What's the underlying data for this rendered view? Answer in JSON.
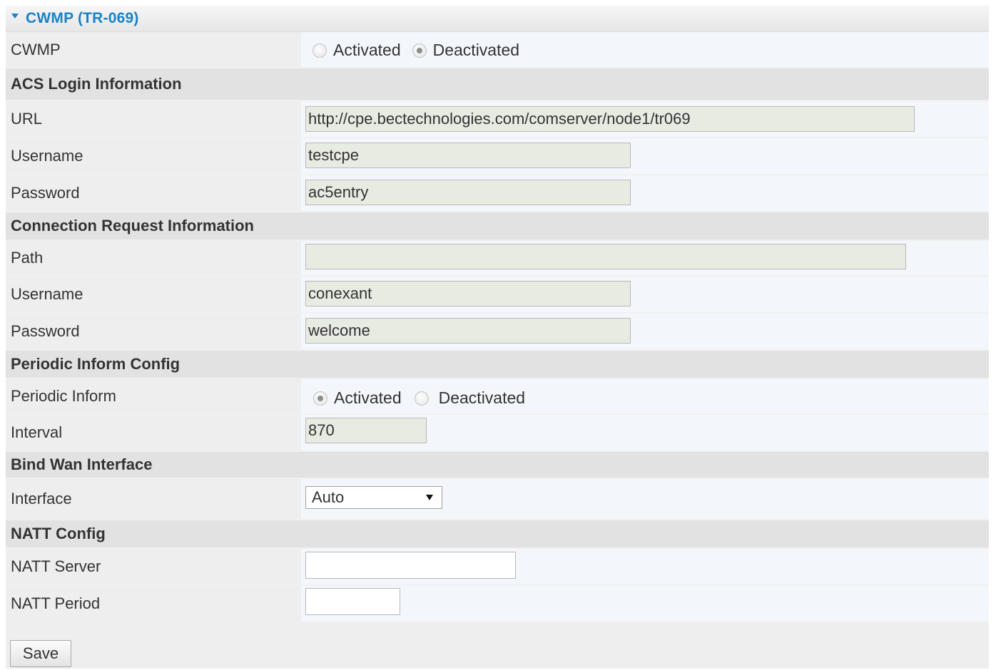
{
  "title": "CWMP (TR-069)",
  "cwmp": {
    "label": "CWMP",
    "options": [
      "Activated",
      "Deactivated"
    ],
    "selected": "Deactivated"
  },
  "acs": {
    "section_title": "ACS Login Information",
    "url_label": "URL",
    "url_value": "http://cpe.bectechnologies.com/comserver/node1/tr069",
    "username_label": "Username",
    "username_value": "testcpe",
    "password_label": "Password",
    "password_value": "ac5entry"
  },
  "conn": {
    "section_title": "Connection Request Information",
    "path_label": "Path",
    "path_value": "",
    "username_label": "Username",
    "username_value": "conexant",
    "password_label": "Password",
    "password_value": "welcome"
  },
  "periodic": {
    "section_title": "Periodic Inform Config",
    "inform_label": "Periodic Inform",
    "options": [
      "Activated",
      "Deactivated"
    ],
    "selected": "Activated",
    "interval_label": "Interval",
    "interval_value": "870"
  },
  "bind": {
    "section_title": "Bind Wan Interface",
    "interface_label": "Interface",
    "interface_value": "Auto"
  },
  "natt": {
    "section_title": "NATT Config",
    "server_label": "NATT Server",
    "server_value": "",
    "period_label": "NATT Period",
    "period_value": ""
  },
  "save_label": "Save"
}
